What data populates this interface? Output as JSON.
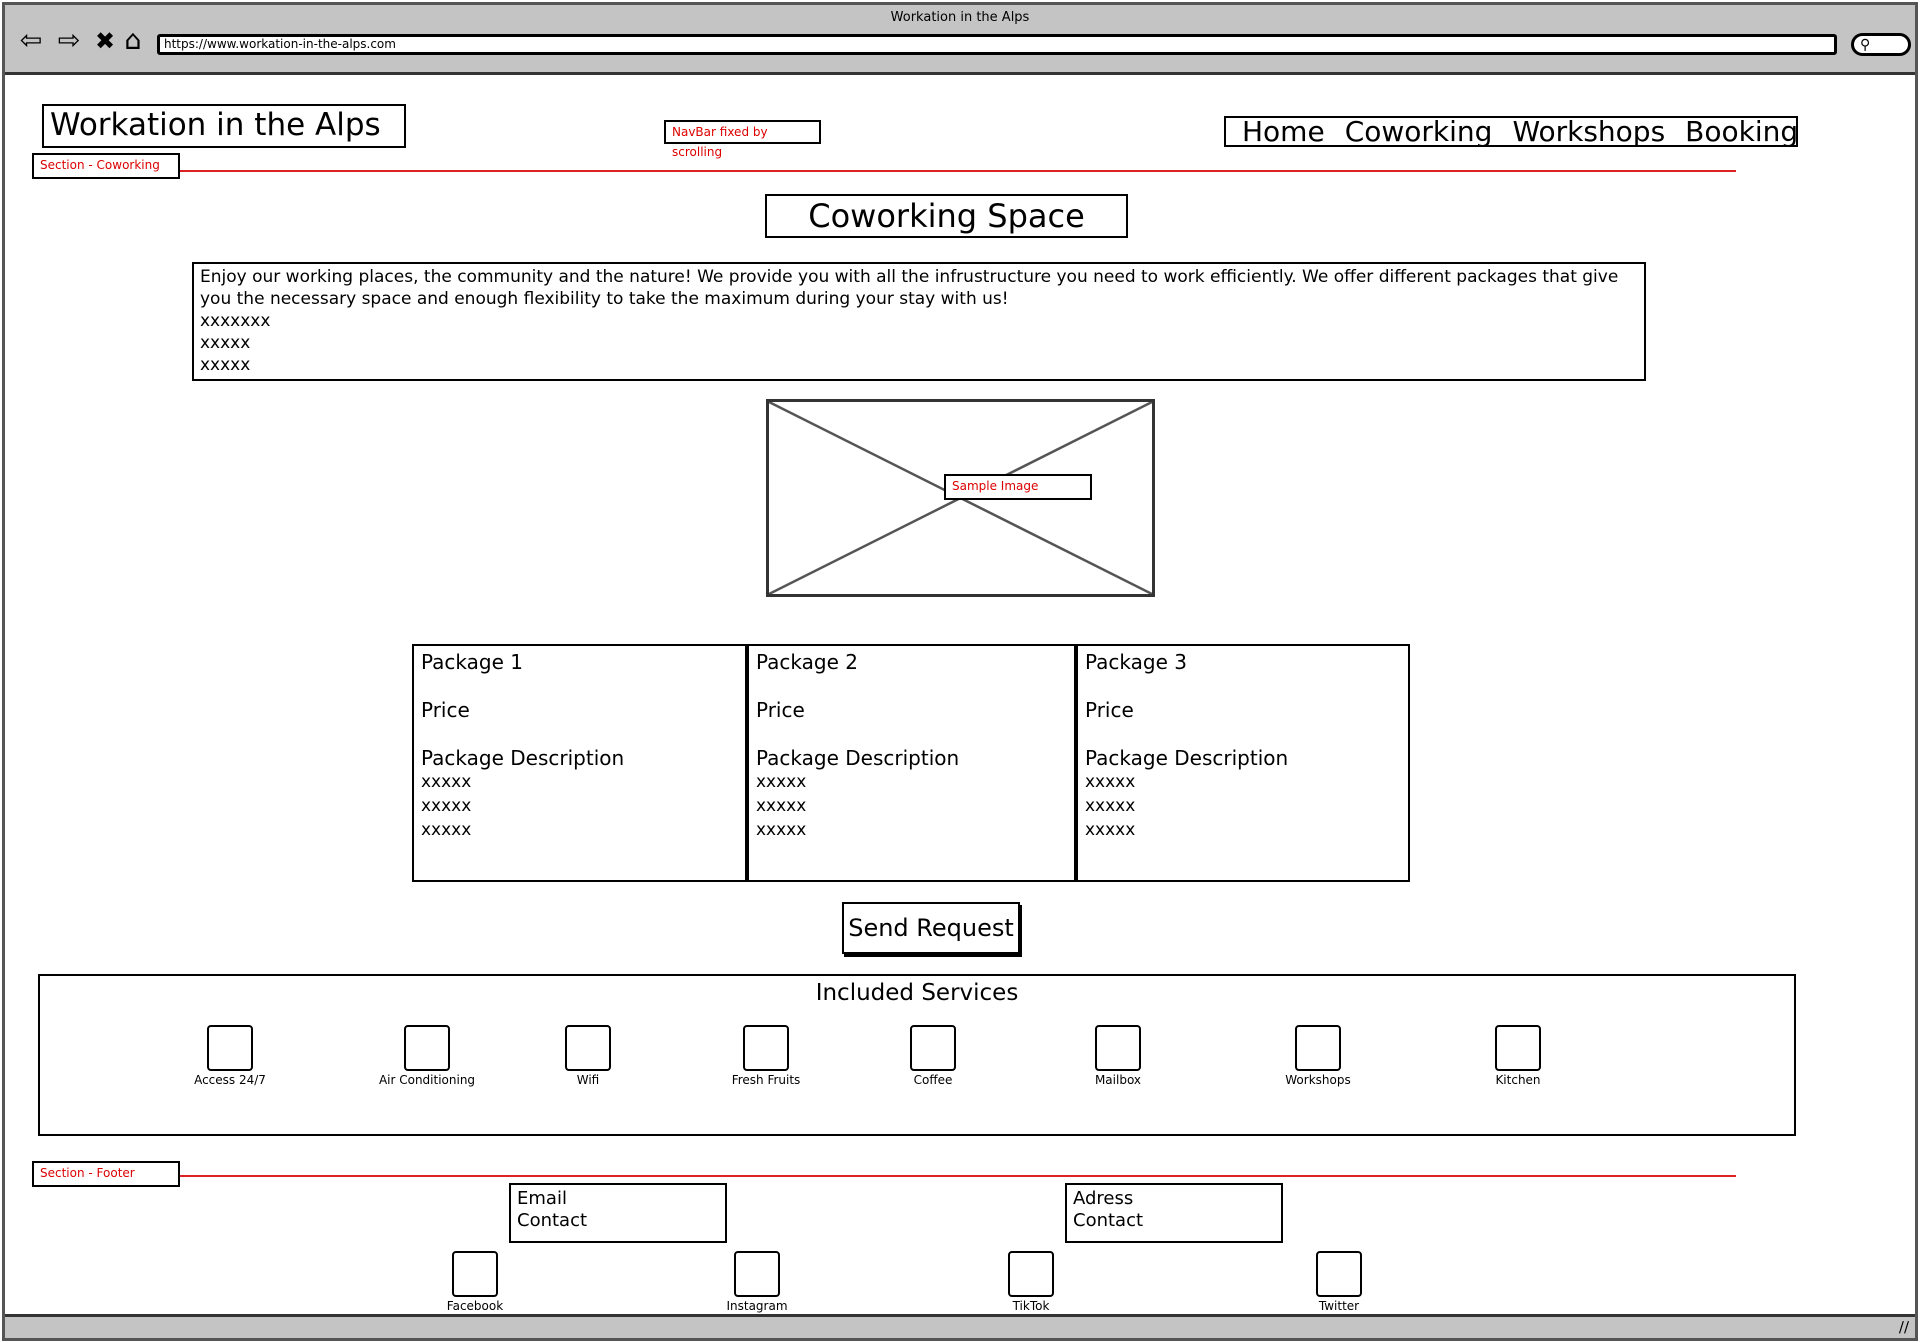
{
  "browser": {
    "window_title": "Workation in the Alps",
    "url": "https://www.workation-in-the-alps.com",
    "back_icon": "back-arrow-icon",
    "forward_icon": "forward-arrow-icon",
    "stop_icon": "close-icon",
    "home_icon": "home-icon",
    "search_icon": "search-icon"
  },
  "header": {
    "logo": "Workation in the Alps",
    "nav": [
      "Home",
      "Coworking",
      "Workshops",
      "Booking"
    ],
    "navbar_note": "NavBar fixed by scrolling"
  },
  "section_notes": {
    "coworking": "Section - Coworking",
    "footer": "Section - Footer"
  },
  "main": {
    "title": "Coworking Space",
    "intro_text": "Enjoy our working places, the community and the nature! We provide you with all the infrustructure you need to work efficiently. We offer different packages that give you the necessary space and enough flexibility to take the maximum during your stay with us!",
    "intro_placeholders": [
      "xxxxxxx",
      "xxxxx",
      "xxxxx"
    ],
    "image_note": "Sample Image",
    "packages": [
      {
        "name": "Package 1",
        "price": "Price",
        "desc": "Package Description",
        "items": [
          "xxxxx",
          "xxxxx",
          "xxxxx"
        ]
      },
      {
        "name": "Package 2",
        "price": "Price",
        "desc": "Package Description",
        "items": [
          "xxxxx",
          "xxxxx",
          "xxxxx"
        ]
      },
      {
        "name": "Package 3",
        "price": "Price",
        "desc": "Package Description",
        "items": [
          "xxxxx",
          "xxxxx",
          "xxxxx"
        ]
      }
    ],
    "send_button": "Send Request"
  },
  "services": {
    "title": "Included Services",
    "items": [
      "Access 24/7",
      "Air Conditioning",
      "Wifi",
      "Fresh Fruits",
      "Coffee",
      "Mailbox",
      "Workshops",
      "Kitchen"
    ]
  },
  "footer": {
    "email": [
      "Email",
      "Contact"
    ],
    "address": [
      "Adress",
      "Contact"
    ],
    "social": [
      "Facebook",
      "Instagram",
      "TikTok",
      "Twitter"
    ]
  }
}
